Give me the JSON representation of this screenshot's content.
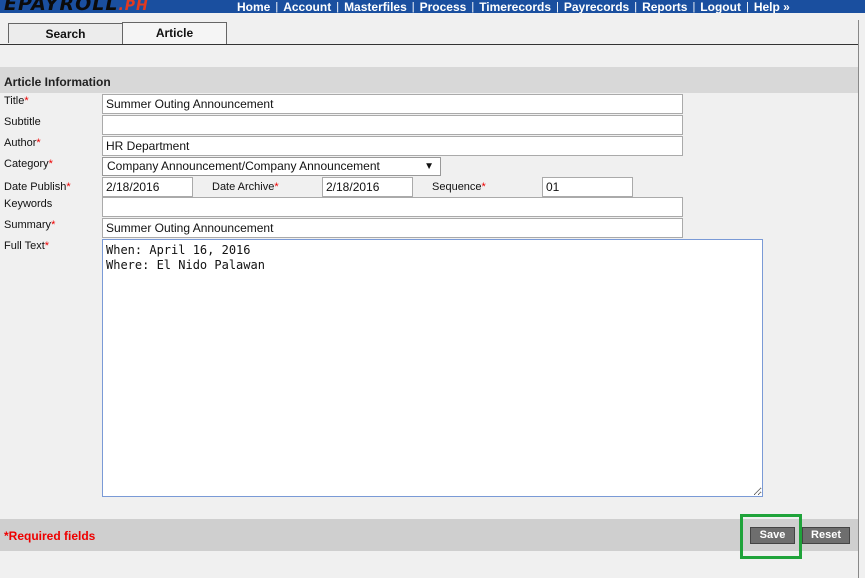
{
  "app": {
    "logo_main": "EPAYROLL",
    "logo_suffix": ".PH"
  },
  "nav": {
    "items": [
      "Home",
      "Account",
      "Masterfiles",
      "Process",
      "Timerecords",
      "Payrecords",
      "Reports",
      "Logout",
      "Help »"
    ],
    "separator": "|"
  },
  "tabs": [
    {
      "label": "Search"
    },
    {
      "label": "Article"
    }
  ],
  "section": {
    "title": "Article Information"
  },
  "form": {
    "required_mark": "*",
    "title": {
      "label": "Title",
      "value": "Summer Outing Announcement"
    },
    "subtitle": {
      "label": "Subtitle",
      "value": ""
    },
    "author": {
      "label": "Author",
      "value": "HR Department"
    },
    "category": {
      "label": "Category",
      "value": "Company Announcement/Company Announcement"
    },
    "date_publish": {
      "label": "Date Publish",
      "value": "2/18/2016"
    },
    "date_archive": {
      "label": "Date Archive",
      "value": "2/18/2016"
    },
    "sequence": {
      "label": "Sequence",
      "value": "01"
    },
    "keywords": {
      "label": "Keywords",
      "value": ""
    },
    "summary": {
      "label": "Summary",
      "value": "Summer Outing Announcement"
    },
    "full_text": {
      "label": "Full Text",
      "value": "When: April 16, 2016\nWhere: El Nido Palawan"
    }
  },
  "footer": {
    "required_note": "*Required fields",
    "save_label": "Save",
    "reset_label": "Reset"
  },
  "colors": {
    "topbar": "#1a4f9f",
    "required": "#ee0000",
    "highlight": "#1fa33a"
  }
}
